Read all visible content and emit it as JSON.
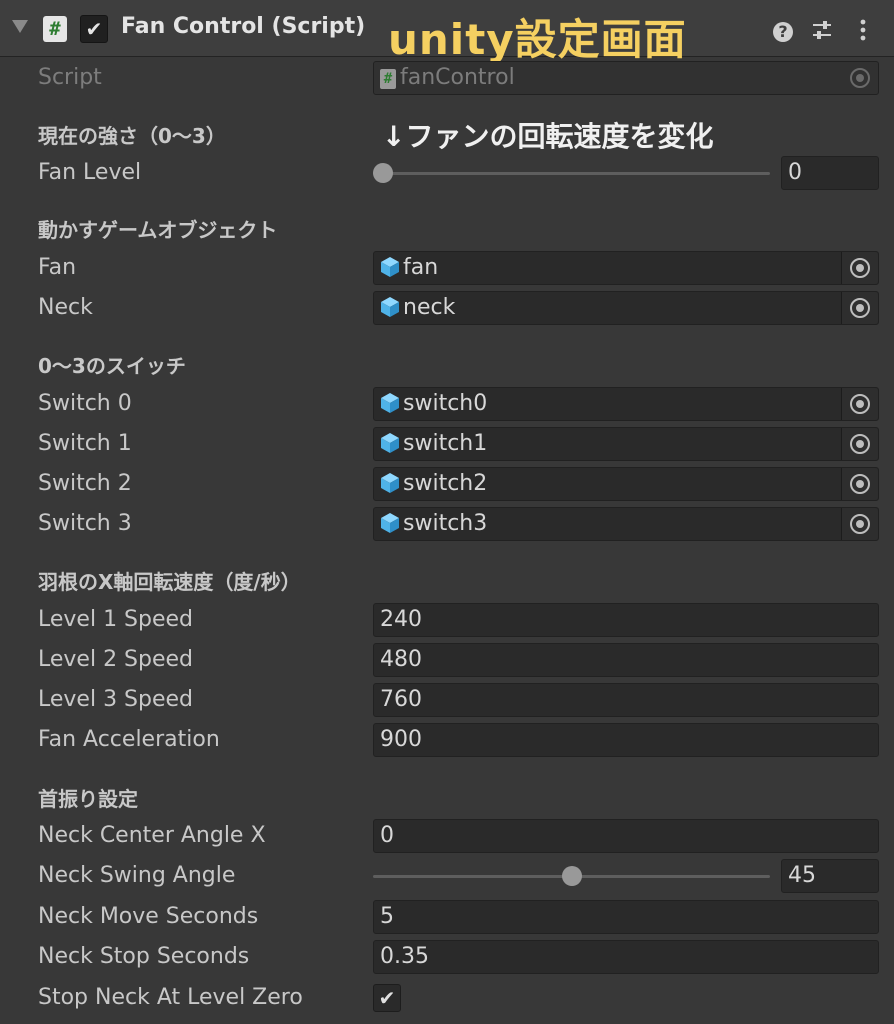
{
  "header": {
    "title": "Fan Control (Script)",
    "script_icon": "#",
    "enabled_check": "✔",
    "overlay_title": "unity設定画面",
    "icons": [
      "foldout-arrow-icon",
      "script-icon",
      "help-icon",
      "preset-icon",
      "kebab-menu-icon"
    ]
  },
  "script_field": {
    "label": "Script",
    "value": "fanControl"
  },
  "annotation": "↓ファンの回転速度を変化",
  "sections": {
    "strength": "現在の強さ（0～3）",
    "objects": "動かすゲームオブジェクト",
    "switches": "0～3のスイッチ",
    "blade": "羽根のX軸回転速度（度/秒）",
    "neck": "首振り設定"
  },
  "fan_level": {
    "label": "Fan Level",
    "value": "0",
    "min": 0,
    "max": 3,
    "fraction": 0.0
  },
  "objects": {
    "fan": {
      "label": "Fan",
      "value": "fan"
    },
    "neck": {
      "label": "Neck",
      "value": "neck"
    }
  },
  "switches": [
    {
      "label": "Switch 0",
      "value": "switch0"
    },
    {
      "label": "Switch 1",
      "value": "switch1"
    },
    {
      "label": "Switch 2",
      "value": "switch2"
    },
    {
      "label": "Switch 3",
      "value": "switch3"
    }
  ],
  "speeds": [
    {
      "label": "Level 1 Speed",
      "value": "240"
    },
    {
      "label": "Level 2 Speed",
      "value": "480"
    },
    {
      "label": "Level 3 Speed",
      "value": "760"
    },
    {
      "label": "Fan Acceleration",
      "value": "900"
    }
  ],
  "neck": {
    "center_angle": {
      "label": "Neck Center Angle X",
      "value": "0"
    },
    "swing_angle": {
      "label": "Neck Swing Angle",
      "value": "45",
      "fraction": 0.5
    },
    "move_seconds": {
      "label": "Neck Move Seconds",
      "value": "5"
    },
    "stop_seconds": {
      "label": "Neck Stop Seconds",
      "value": "0.35"
    },
    "stop_at_zero": {
      "label": "Stop Neck At Level Zero",
      "checked": true,
      "mark": "✔"
    }
  },
  "colors": {
    "background": "#383838",
    "field": "#2a2a2a",
    "overlay_title": "#f5d061",
    "cube_icon": "#4fc3f7"
  }
}
